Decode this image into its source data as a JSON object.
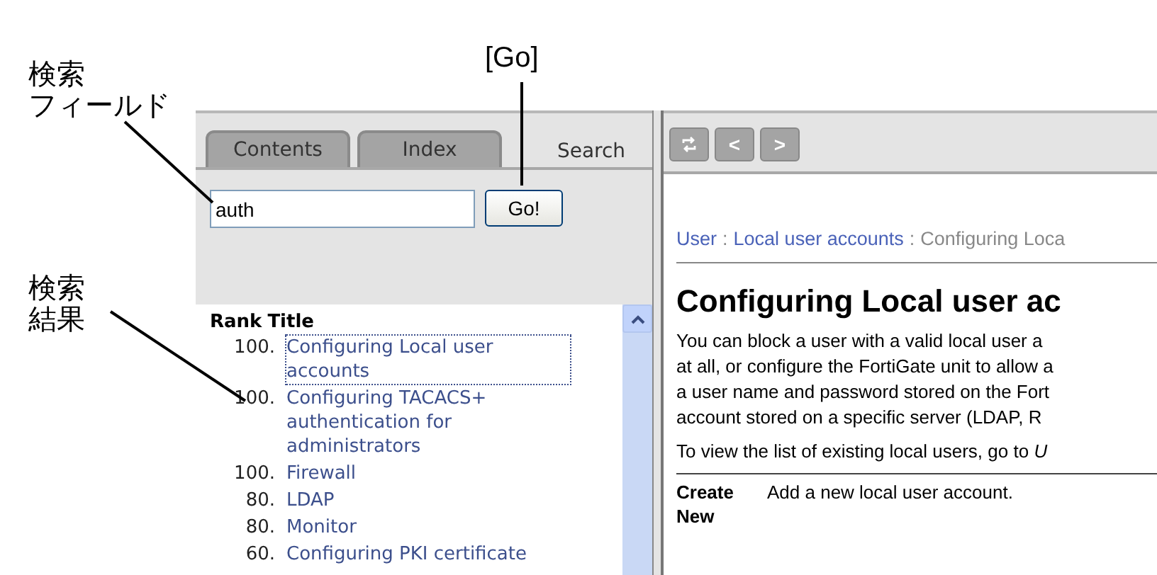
{
  "callouts": [
    {
      "kind": "go",
      "lines": [
        "[Go]"
      ]
    },
    {
      "kind": "field",
      "lines": [
        "検索",
        "フィールド"
      ]
    },
    {
      "kind": "results",
      "lines": [
        "検索",
        "結果"
      ]
    }
  ],
  "tabs": [
    {
      "label": "Contents",
      "selected": false
    },
    {
      "label": "Index",
      "selected": false
    },
    {
      "label": "Search",
      "selected": true
    }
  ],
  "search": {
    "value": "auth",
    "button": "Go!"
  },
  "results": {
    "columns": [
      "Rank",
      "Title"
    ],
    "rows": [
      {
        "rank": "100.",
        "title": "Configuring Local user accounts",
        "selected": true
      },
      {
        "rank": "100.",
        "title": "Configuring TACACS+ authentication for administrators",
        "selected": false
      },
      {
        "rank": "100.",
        "title": "Firewall",
        "selected": false
      },
      {
        "rank": "80.",
        "title": "LDAP",
        "selected": false
      },
      {
        "rank": "80.",
        "title": "Monitor",
        "selected": false
      },
      {
        "rank": "60.",
        "title": "Configuring PKI certificate",
        "selected": false
      }
    ]
  },
  "toolbar": [
    {
      "kind": "sync"
    },
    {
      "kind": "text",
      "label": "<"
    },
    {
      "kind": "text",
      "label": ">"
    }
  ],
  "breadcrumb": {
    "separator": ":",
    "items": [
      {
        "text": "User",
        "kind": "link"
      },
      {
        "text": "Local user accounts",
        "kind": "link"
      },
      {
        "text": "Configuring Loca",
        "kind": "current"
      }
    ]
  },
  "heading": "Configuring Local user ac",
  "paragraphs": [
    {
      "lines": [
        "You can block a user with a valid local user a",
        "at all, or configure the FortiGate unit to allow a",
        "a user name and password stored on the Fort",
        "account stored on a specific server (LDAP, R"
      ]
    },
    {
      "lines": [
        "To view the list of existing local users, go to *U*"
      ]
    }
  ],
  "table": [
    {
      "term": "Create New",
      "description": "Add a new local user account."
    }
  ]
}
